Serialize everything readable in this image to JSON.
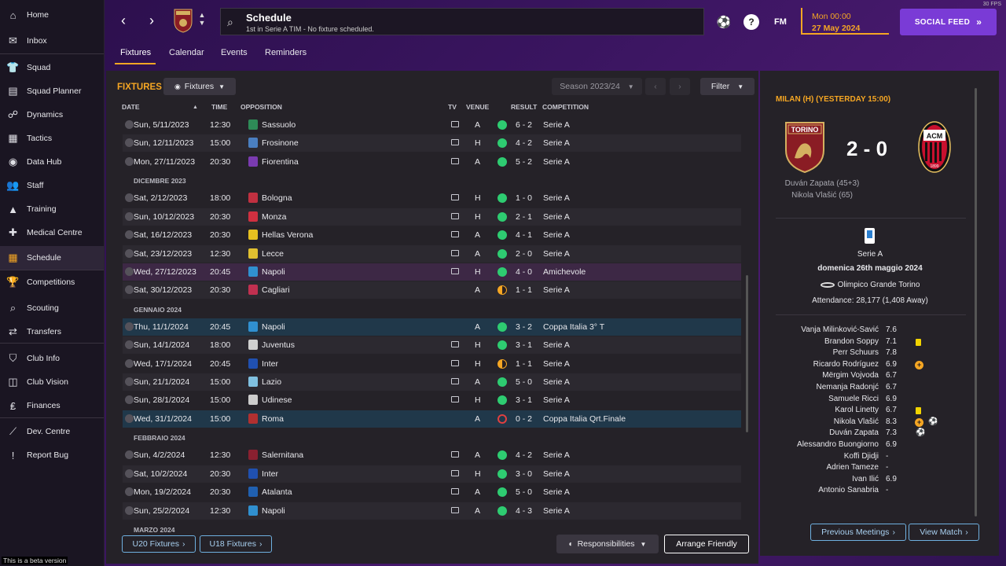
{
  "sidebar": {
    "items": [
      {
        "label": "Home",
        "icon": "home-icon",
        "glyph": "⌂"
      },
      {
        "label": "Inbox",
        "icon": "inbox-icon",
        "glyph": "✉"
      },
      {
        "label": "Squad",
        "icon": "squad-icon",
        "glyph": "👕"
      },
      {
        "label": "Squad Planner",
        "icon": "planner-icon",
        "glyph": "▤"
      },
      {
        "label": "Dynamics",
        "icon": "dynamics-icon",
        "glyph": "☍"
      },
      {
        "label": "Tactics",
        "icon": "tactics-icon",
        "glyph": "▦"
      },
      {
        "label": "Data Hub",
        "icon": "data-hub-icon",
        "glyph": "◉"
      },
      {
        "label": "Staff",
        "icon": "staff-icon",
        "glyph": "👥"
      },
      {
        "label": "Training",
        "icon": "training-icon",
        "glyph": "▲"
      },
      {
        "label": "Medical Centre",
        "icon": "medical-icon",
        "glyph": "✚"
      },
      {
        "label": "Schedule",
        "icon": "calendar-icon",
        "glyph": "▦"
      },
      {
        "label": "Competitions",
        "icon": "trophy-icon",
        "glyph": "🏆"
      },
      {
        "label": "Scouting",
        "icon": "scouting-icon",
        "glyph": "⌕"
      },
      {
        "label": "Transfers",
        "icon": "transfers-icon",
        "glyph": "⇄"
      },
      {
        "label": "Club Info",
        "icon": "shield-icon",
        "glyph": "⛉"
      },
      {
        "label": "Club Vision",
        "icon": "briefcase-icon",
        "glyph": "◫"
      },
      {
        "label": "Finances",
        "icon": "finances-icon",
        "glyph": "₤"
      },
      {
        "label": "Dev. Centre",
        "icon": "dev-centre-icon",
        "glyph": "⟋"
      },
      {
        "label": "Report Bug",
        "icon": "report-bug-icon",
        "glyph": "!"
      }
    ],
    "beta_text": "This is a beta version"
  },
  "topbar": {
    "title": "Schedule",
    "subtitle": "1st in Serie A TIM - No fixture scheduled.",
    "fm_label": "FM",
    "help_label": "?",
    "date_time": "Mon 00:00",
    "date": "27 May 2024",
    "social_label": "SOCIAL FEED",
    "fps": "30 FPS"
  },
  "tabs": [
    "Fixtures",
    "Calendar",
    "Events",
    "Reminders"
  ],
  "fixtures": {
    "title": "FIXTURES",
    "view_label": "Fixtures",
    "season": "Season 2023/24",
    "filter": "Filter",
    "columns": {
      "date": "DATE",
      "time": "TIME",
      "opposition": "OPPOSITION",
      "tv": "TV",
      "venue": "VENUE",
      "result": "RESULT",
      "competition": "COMPETITION"
    },
    "rows": [
      {
        "type": "match",
        "date": "Sun, 5/11/2023",
        "time": "12:30",
        "opp": "Sassuolo",
        "tv": true,
        "venue": "A",
        "res": "W",
        "score": "6 - 2",
        "comp": "Serie A",
        "badge": "#2e8b57"
      },
      {
        "type": "match",
        "date": "Sun, 12/11/2023",
        "time": "15:00",
        "opp": "Frosinone",
        "tv": true,
        "venue": "H",
        "res": "W",
        "score": "4 - 2",
        "comp": "Serie A",
        "badge": "#4a7fc0"
      },
      {
        "type": "match",
        "date": "Mon, 27/11/2023",
        "time": "20:30",
        "opp": "Fiorentina",
        "tv": true,
        "venue": "A",
        "res": "W",
        "score": "5 - 2",
        "comp": "Serie A",
        "badge": "#7a3bb0"
      },
      {
        "type": "month",
        "label": "DICEMBRE 2023"
      },
      {
        "type": "match",
        "date": "Sat, 2/12/2023",
        "time": "18:00",
        "opp": "Bologna",
        "tv": true,
        "venue": "H",
        "res": "W",
        "score": "1 - 0",
        "comp": "Serie A",
        "badge": "#c03040"
      },
      {
        "type": "match",
        "date": "Sun, 10/12/2023",
        "time": "20:30",
        "opp": "Monza",
        "tv": true,
        "venue": "H",
        "res": "W",
        "score": "2 - 1",
        "comp": "Serie A",
        "badge": "#d03040"
      },
      {
        "type": "match",
        "date": "Sat, 16/12/2023",
        "time": "20:30",
        "opp": "Hellas Verona",
        "tv": true,
        "venue": "A",
        "res": "W",
        "score": "4 - 1",
        "comp": "Serie A",
        "badge": "#e6c020"
      },
      {
        "type": "match",
        "date": "Sat, 23/12/2023",
        "time": "12:30",
        "opp": "Lecce",
        "tv": true,
        "venue": "A",
        "res": "W",
        "score": "2 - 0",
        "comp": "Serie A",
        "badge": "#e0c030"
      },
      {
        "type": "match",
        "date": "Wed, 27/12/2023",
        "time": "20:45",
        "opp": "Napoli",
        "tv": true,
        "venue": "H",
        "res": "W",
        "score": "4 - 0",
        "comp": "Amichevole",
        "badge": "#3090d0",
        "hl": "purple"
      },
      {
        "type": "match",
        "date": "Sat, 30/12/2023",
        "time": "20:30",
        "opp": "Cagliari",
        "tv": false,
        "venue": "A",
        "res": "D",
        "score": "1 - 1",
        "comp": "Serie A",
        "badge": "#c03050"
      },
      {
        "type": "month",
        "label": "GENNAIO 2024"
      },
      {
        "type": "match",
        "date": "Thu, 11/1/2024",
        "time": "20:45",
        "opp": "Napoli",
        "tv": false,
        "venue": "A",
        "res": "W",
        "score": "3 - 2",
        "comp": "Coppa Italia 3° T",
        "badge": "#3090d0",
        "hl": "blue"
      },
      {
        "type": "match",
        "date": "Sun, 14/1/2024",
        "time": "18:00",
        "opp": "Juventus",
        "tv": true,
        "venue": "H",
        "res": "W",
        "score": "3 - 1",
        "comp": "Serie A",
        "badge": "#d0d0d0"
      },
      {
        "type": "match",
        "date": "Wed, 17/1/2024",
        "time": "20:45",
        "opp": "Inter",
        "tv": true,
        "venue": "H",
        "res": "D",
        "score": "1 - 1",
        "comp": "Serie A",
        "badge": "#2050b0"
      },
      {
        "type": "match",
        "date": "Sun, 21/1/2024",
        "time": "15:00",
        "opp": "Lazio",
        "tv": true,
        "venue": "A",
        "res": "W",
        "score": "5 - 0",
        "comp": "Serie A",
        "badge": "#80c0e0"
      },
      {
        "type": "match",
        "date": "Sun, 28/1/2024",
        "time": "15:00",
        "opp": "Udinese",
        "tv": true,
        "venue": "H",
        "res": "W",
        "score": "3 - 1",
        "comp": "Serie A",
        "badge": "#cccccc"
      },
      {
        "type": "match",
        "date": "Wed, 31/1/2024",
        "time": "15:00",
        "opp": "Roma",
        "tv": false,
        "venue": "A",
        "res": "L",
        "score": "0 - 2",
        "comp": "Coppa Italia Qrt.Finale",
        "badge": "#b03030",
        "hl": "blue"
      },
      {
        "type": "month",
        "label": "FEBBRAIO 2024"
      },
      {
        "type": "match",
        "date": "Sun, 4/2/2024",
        "time": "12:30",
        "opp": "Salernitana",
        "tv": true,
        "venue": "A",
        "res": "W",
        "score": "4 - 2",
        "comp": "Serie A",
        "badge": "#8a2030"
      },
      {
        "type": "match",
        "date": "Sat, 10/2/2024",
        "time": "20:30",
        "opp": "Inter",
        "tv": true,
        "venue": "H",
        "res": "W",
        "score": "3 - 0",
        "comp": "Serie A",
        "badge": "#2050b0"
      },
      {
        "type": "match",
        "date": "Mon, 19/2/2024",
        "time": "20:30",
        "opp": "Atalanta",
        "tv": true,
        "venue": "A",
        "res": "W",
        "score": "5 - 0",
        "comp": "Serie A",
        "badge": "#2060b0"
      },
      {
        "type": "match",
        "date": "Sun, 25/2/2024",
        "time": "12:30",
        "opp": "Napoli",
        "tv": true,
        "venue": "A",
        "res": "W",
        "score": "4 - 3",
        "comp": "Serie A",
        "badge": "#3090d0"
      },
      {
        "type": "month",
        "label": "MARZO 2024"
      }
    ],
    "u20": "U20 Fixtures",
    "u18": "U18 Fixtures",
    "responsibilities": "Responsibilities",
    "arrange": "Arrange Friendly"
  },
  "colors": {
    "win": "#2ecc71",
    "draw": "#f5a623",
    "loss": "#e04040",
    "accent": "#f5a623"
  },
  "match": {
    "title": "MILAN (H) (YESTERDAY 15:00)",
    "home_crest_text": "TORINO",
    "away_crest_text": "ACM",
    "away_crest_year": "1899",
    "score": "2 - 0",
    "scorers": [
      "Duván Zapata (45+3)",
      "Nikola Vlašić (65)"
    ],
    "competition": "Serie A",
    "date": "domenica 26th maggio 2024",
    "stadium": "Olimpico Grande Torino",
    "attendance": "Attendance: 28,177 (1,408 Away)",
    "players": [
      {
        "name": "Vanja Milinković-Savić",
        "rating": "7.6",
        "marks": []
      },
      {
        "name": "Brandon Soppy",
        "rating": "7.1",
        "marks": [
          "yc"
        ]
      },
      {
        "name": "Perr Schuurs",
        "rating": "7.8",
        "marks": []
      },
      {
        "name": "Ricardo Rodríguez",
        "rating": "6.9",
        "marks": [
          "sub"
        ]
      },
      {
        "name": "Mërgim Vojvoda",
        "rating": "6.7",
        "marks": []
      },
      {
        "name": "Nemanja Radonjć",
        "rating": "6.7",
        "marks": []
      },
      {
        "name": "Samuele Ricci",
        "rating": "6.9",
        "marks": []
      },
      {
        "name": "Karol Linetty",
        "rating": "6.7",
        "marks": [
          "yc"
        ]
      },
      {
        "name": "Nikola Vlašić",
        "rating": "8.3",
        "marks": [
          "sub",
          "ball"
        ]
      },
      {
        "name": "Duván Zapata",
        "rating": "7.3",
        "marks": [
          "ball"
        ]
      },
      {
        "name": "Alessandro Buongiorno",
        "rating": "6.9",
        "marks": []
      },
      {
        "name": "Koffi Djidji",
        "rating": "-",
        "marks": []
      },
      {
        "name": "Adrien Tameze",
        "rating": "-",
        "marks": []
      },
      {
        "name": "Ivan Ilić",
        "rating": "6.9",
        "marks": []
      },
      {
        "name": "Antonio Sanabria",
        "rating": "-",
        "marks": []
      }
    ],
    "prev_meetings": "Previous Meetings",
    "view_match": "View Match"
  }
}
